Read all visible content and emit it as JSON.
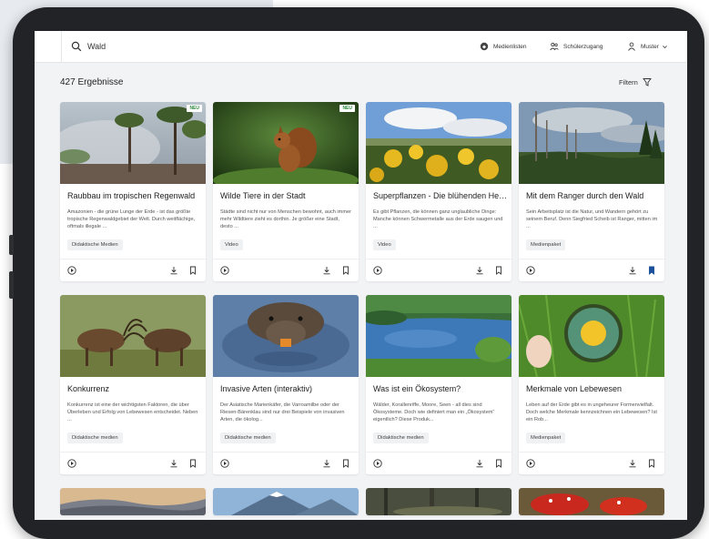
{
  "search": {
    "placeholder": "Wald",
    "value": "Wald"
  },
  "nav": [
    {
      "label": "Medienlisten",
      "icon": "media-list-icon"
    },
    {
      "label": "Schülerzugang",
      "icon": "students-icon"
    },
    {
      "label": "Muster",
      "icon": "user-icon"
    }
  ],
  "results": {
    "count_label": "427 Ergebnisse",
    "filter_label": "Filtern"
  },
  "colors": {
    "accent": "#1a4f9c",
    "new_badge": "#2e8b3f"
  },
  "cards": [
    {
      "title": "Raubbau im tropischen Regenwald",
      "desc": "Amazonien - die grüne Lunge der Erde - ist das größte tropische Regenwaldgebiet der Welt. Durch weitflächige, oftmals illegale ...",
      "tag": "Didaktische Medien",
      "badge": "NEU",
      "bookmarked": false,
      "image": "rainforest-fire"
    },
    {
      "title": "Wilde Tiere in der Stadt",
      "desc": "Städte sind nicht nur von Menschen bewohnt, auch immer mehr Wildtiere zieht es dorthin. Je größer eine Stadt, desto ...",
      "tag": "Video",
      "badge": "NEU",
      "bookmarked": false,
      "image": "squirrel"
    },
    {
      "title": "Superpflanzen - Die blühenden Helfer",
      "desc": "Es gibt Pflanzen, die können ganz unglaubliche Dinge: Manche können Schwermetalle aus der Erde saugen und ...",
      "tag": "Video",
      "badge": "",
      "bookmarked": false,
      "image": "yellow-flowers"
    },
    {
      "title": "Mit dem Ranger durch den Wald",
      "desc": "Sein Arbeitsplatz ist die Natur, und Wandern gehört zu seinem Beruf. Denn Siegfried Scheib ist Ranger, mitten im ...",
      "tag": "Medienpaket",
      "badge": "",
      "bookmarked": true,
      "image": "dead-forest"
    },
    {
      "title": "Konkurrenz",
      "desc": "Konkurrenz ist eine der wichtigsten Faktoren, die über Überleben und Erfolg von Lebewesen entscheidet. Neben ...",
      "tag": "Didaktische medien",
      "badge": "",
      "bookmarked": false,
      "image": "deer-fight"
    },
    {
      "title": "Invasive Arten (interaktiv)",
      "desc": "Der Asiatische Marienkäfer, die Varroamilbe oder der Riesen-Bärenklau sind nur drei Beispiele von invasiven Arten, die ökolog...",
      "tag": "Didaktische medien",
      "badge": "",
      "bookmarked": false,
      "image": "nutria"
    },
    {
      "title": "Was ist ein Ökosystem?",
      "desc": "Wälder, Korallenriffe, Moore, Seen - all dies sind Ökosysteme. Doch wie definiert man ein „Ökosystem“ eigentlich? Diese Produk...",
      "tag": "Didaktische medien",
      "badge": "",
      "bookmarked": false,
      "image": "lake"
    },
    {
      "title": "Merkmale von Lebewesen",
      "desc": "Leben auf der Erde gibt es in ungeheurer Formenvielfalt. Doch welche Merkmale kennzeichnen ein Lebewesen? Ist ein Rob...",
      "tag": "Medienpaket",
      "badge": "",
      "bookmarked": false,
      "image": "magnifier-dandelion"
    },
    {
      "image": "hills-sunset"
    },
    {
      "image": "mountain"
    },
    {
      "image": "forest-floor"
    },
    {
      "image": "mushrooms"
    }
  ]
}
